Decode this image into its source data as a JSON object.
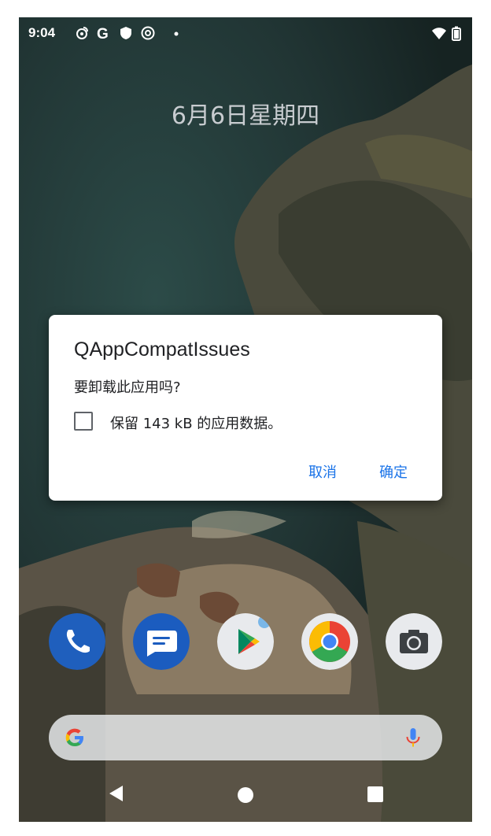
{
  "status_bar": {
    "time": "9:04",
    "left_icons": [
      "weibo-icon",
      "google-g-icon",
      "shield-icon",
      "sync-icon",
      "dot-icon"
    ],
    "right_icons": [
      "wifi-icon",
      "battery-icon"
    ]
  },
  "lock_date": "6月6日星期四",
  "dialog": {
    "title": "QAppCompatIssues",
    "message": "要卸载此应用吗?",
    "checkbox_label": "保留 143 kB 的应用数据。",
    "checkbox_checked": false,
    "cancel_label": "取消",
    "ok_label": "确定",
    "accent_color": "#1a73e8"
  },
  "dock": [
    {
      "name": "phone-app-icon"
    },
    {
      "name": "messages-app-icon"
    },
    {
      "name": "play-store-app-icon",
      "badge": true
    },
    {
      "name": "chrome-app-icon"
    },
    {
      "name": "camera-app-icon"
    }
  ],
  "search_bar": {
    "left_icon": "google-g-icon",
    "right_icon": "mic-icon"
  },
  "nav_bar": [
    "back-icon",
    "home-icon",
    "recents-icon"
  ]
}
